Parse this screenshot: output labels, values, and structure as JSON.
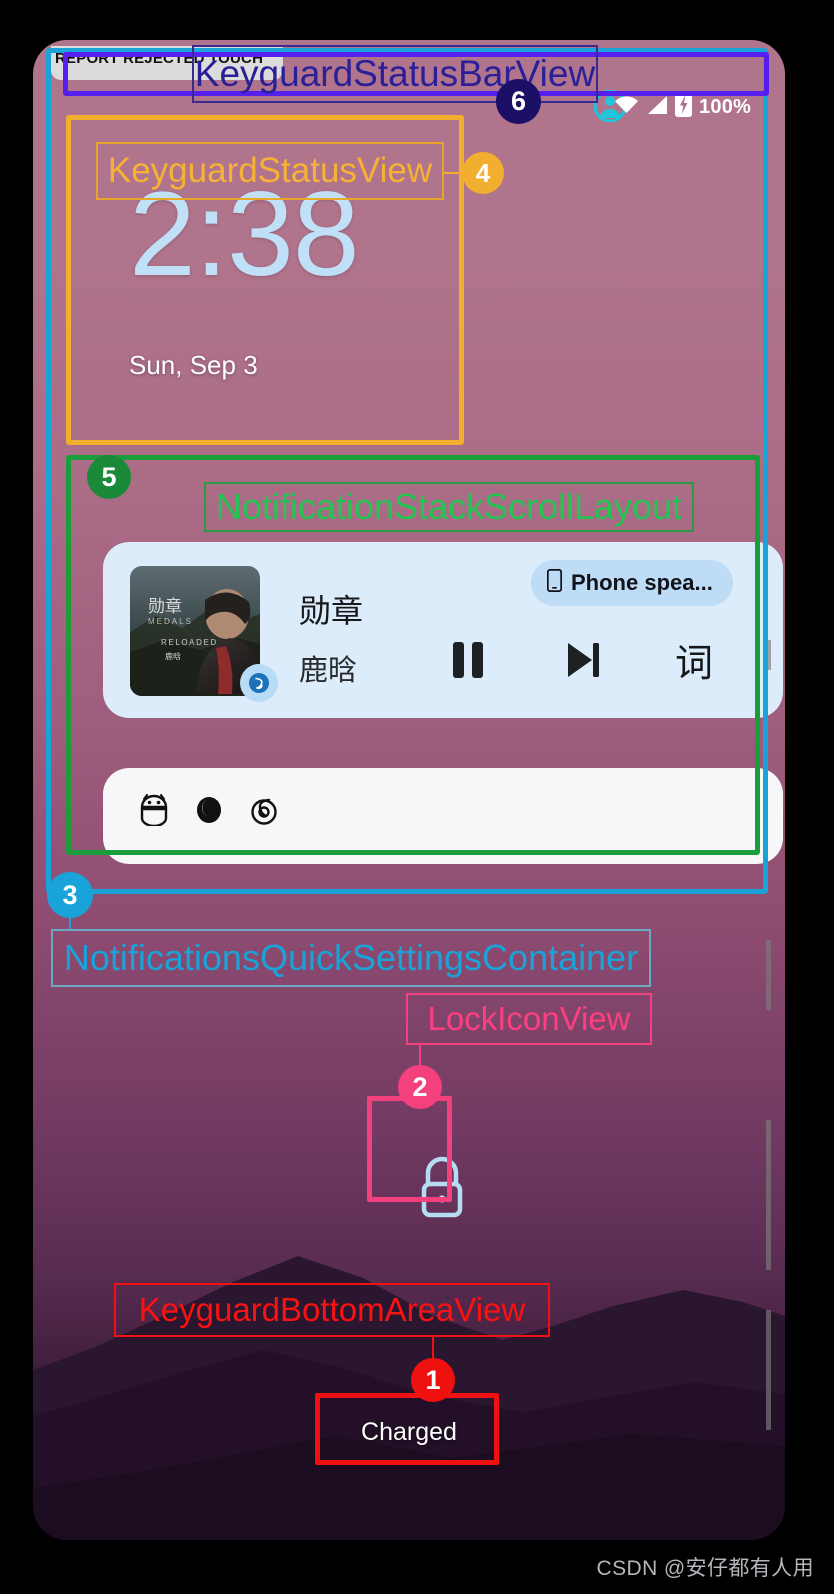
{
  "statusbar": {
    "rejected_touch_label": "REPORT REJECTED TOUCH",
    "battery_percent": "100%",
    "icons": [
      "wifi-icon",
      "signal-icon",
      "battery-charging-icon",
      "user-avatar-icon"
    ]
  },
  "keyguard": {
    "clock_time": "2:38",
    "date": "Sun, Sep 3",
    "charged_label": "Charged"
  },
  "media": {
    "title": "勋章",
    "artist": "鹿晗",
    "output_chip": "Phone spea...",
    "album_art": {
      "title_cn": "勋章",
      "title_en": "MEDALS",
      "edition": "RELOADED",
      "artist_cn": "鹿晗"
    },
    "controls": [
      {
        "name": "pause-button",
        "icon": "pause-icon"
      },
      {
        "name": "next-track-button",
        "icon": "skip-next-icon"
      },
      {
        "name": "lyrics-button",
        "icon": "词"
      }
    ]
  },
  "shelf": {
    "icons": [
      "android-robot-icon",
      "circle-dot-icon",
      "netease-music-icon"
    ]
  },
  "annotations": [
    {
      "id": 1,
      "label": "KeyguardBottomAreaView",
      "color": "#ef1010",
      "badge": "1"
    },
    {
      "id": 2,
      "label": "LockIconView",
      "color": "#f5407e",
      "badge": "2"
    },
    {
      "id": 3,
      "label": "NotificationsQuickSettingsContainer",
      "color": "#19a3d8",
      "badge": "3"
    },
    {
      "id": 4,
      "label": "KeyguardStatusView",
      "color": "#f2ae2e",
      "badge": "4"
    },
    {
      "id": 5,
      "label": "NotificationStackScrollLayout",
      "color": "#1a9e3c",
      "badge": "5"
    },
    {
      "id": 6,
      "label": "KeyguardStatusBarView",
      "color": "#2a1f96",
      "badge": "6"
    }
  ],
  "watermark": "CSDN @安仔都有人用"
}
